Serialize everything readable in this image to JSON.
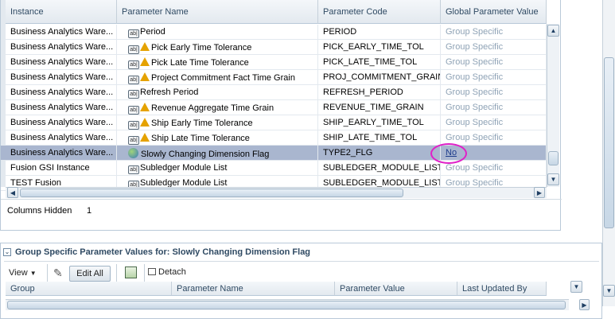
{
  "grid": {
    "headers": [
      "Instance",
      "Parameter Name",
      "Parameter Code",
      "Global Parameter Value"
    ],
    "rows": [
      {
        "instance": "Business Analytics Ware...",
        "name": "Period",
        "code": "PERIOD",
        "value": "Group Specific",
        "warn": false,
        "icon": "text-field-icon"
      },
      {
        "instance": "Business Analytics Ware...",
        "name": "Pick Early Time Tolerance",
        "code": "PICK_EARLY_TIME_TOL",
        "value": "Group Specific",
        "warn": true,
        "icon": "text-field-icon"
      },
      {
        "instance": "Business Analytics Ware...",
        "name": "Pick Late Time Tolerance",
        "code": "PICK_LATE_TIME_TOL",
        "value": "Group Specific",
        "warn": true,
        "icon": "text-field-icon"
      },
      {
        "instance": "Business Analytics Ware...",
        "name": "Project Commitment Fact Time Grain",
        "code": "PROJ_COMMITMENT_GRAIN",
        "value": "Group Specific",
        "warn": true,
        "icon": "text-field-icon"
      },
      {
        "instance": "Business Analytics Ware...",
        "name": "Refresh Period",
        "code": "REFRESH_PERIOD",
        "value": "Group Specific",
        "warn": false,
        "icon": "text-field-icon"
      },
      {
        "instance": "Business Analytics Ware...",
        "name": "Revenue Aggregate Time Grain",
        "code": "REVENUE_TIME_GRAIN",
        "value": "Group Specific",
        "warn": true,
        "icon": "text-field-icon"
      },
      {
        "instance": "Business Analytics Ware...",
        "name": "Ship Early Time Tolerance",
        "code": "SHIP_EARLY_TIME_TOL",
        "value": "Group Specific",
        "warn": true,
        "icon": "text-field-icon"
      },
      {
        "instance": "Business Analytics Ware...",
        "name": "Ship Late Time Tolerance",
        "code": "SHIP_LATE_TIME_TOL",
        "value": "Group Specific",
        "warn": true,
        "icon": "text-field-icon"
      },
      {
        "instance": "Business Analytics Ware...",
        "name": "Slowly Changing Dimension Flag",
        "code": "TYPE2_FLG",
        "value": "No",
        "warn": false,
        "icon": "globe-icon",
        "selected": true
      },
      {
        "instance": "Fusion GSI Instance",
        "name": "Subledger Module List",
        "code": "SUBLEDGER_MODULE_LIST",
        "value": "Group Specific",
        "warn": false,
        "icon": "text-field-icon"
      },
      {
        "instance": "TEST Fusion",
        "name": "Subledger Module List",
        "code": "SUBLEDGER_MODULE_LIST",
        "value": "Group Specific",
        "warn": false,
        "icon": "text-field-icon"
      }
    ],
    "columns_hidden_label": "Columns Hidden",
    "columns_hidden_count": "1"
  },
  "detail": {
    "title": "Group Specific Parameter Values for: Slowly Changing Dimension Flag",
    "view_label": "View",
    "edit_all_label": "Edit All",
    "detach_label": "Detach",
    "headers": [
      "Group",
      "Parameter Name",
      "Parameter Value",
      "Last Updated By"
    ]
  },
  "colors": {
    "selected_row": "#a9b6cf",
    "link": "#1c3c8c",
    "highlight_circle": "#e020c8",
    "group_specific": "#8fa3b6"
  }
}
